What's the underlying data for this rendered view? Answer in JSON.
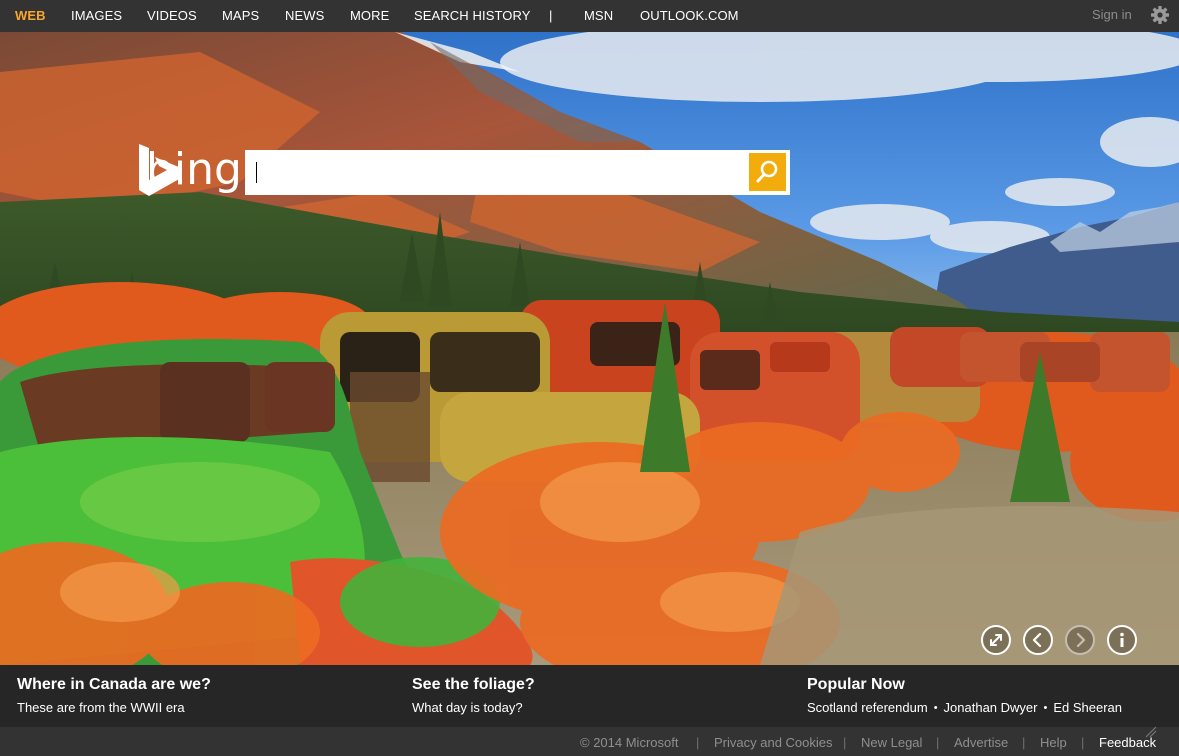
{
  "nav": {
    "items": [
      {
        "label": "WEB",
        "active": true
      },
      {
        "label": "IMAGES"
      },
      {
        "label": "VIDEOS"
      },
      {
        "label": "MAPS"
      },
      {
        "label": "NEWS"
      },
      {
        "label": "MORE"
      },
      {
        "label": "SEARCH HISTORY"
      },
      {
        "label": "MSN"
      },
      {
        "label": "OUTLOOK.COM"
      }
    ],
    "separator": "|",
    "sign_in": "Sign in",
    "settings_icon": "gear-icon"
  },
  "logo": {
    "text": "bing"
  },
  "search": {
    "value": "",
    "placeholder": "",
    "button_icon": "search-icon"
  },
  "hero_controls": {
    "icons": [
      "expand-icon",
      "chevron-left-icon",
      "chevron-right-icon",
      "info-icon"
    ]
  },
  "captions": [
    {
      "title": "Where in Canada are we?",
      "subtitle": "These are from the WWII era"
    },
    {
      "title": "See the foliage?",
      "subtitle": "What day is today?"
    }
  ],
  "popular": {
    "title": "Popular Now",
    "items": [
      "Scotland referendum",
      "Jonathan Dwyer",
      "Ed Sheeran"
    ],
    "separator": "•"
  },
  "footer": {
    "copyright": "© 2014 Microsoft",
    "links": [
      "Privacy and Cookies",
      "New Legal",
      "Advertise",
      "Help"
    ],
    "feedback": "Feedback",
    "separator": "|"
  },
  "colors": {
    "nav_bg": "#333333",
    "active_nav": "#f8a72c",
    "search_button": "#f2ad0c",
    "caption_bg": "#282828"
  }
}
